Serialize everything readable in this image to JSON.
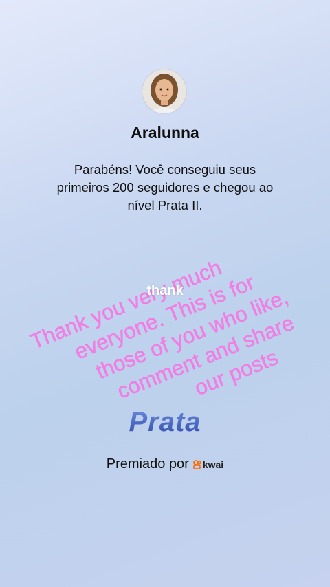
{
  "profile": {
    "username": "Aralunna",
    "avatar_icon": "user-avatar-photo"
  },
  "message": "Parabéns! Você conseguiu seus primeiros 200 seguidores e chegou ao nível Prata II.",
  "overlay": {
    "thank_word": "thank",
    "handwritten_lines": [
      "Thank you very much",
      "everyone. This is for",
      "those of you who like,",
      "comment and share",
      "our posts"
    ],
    "text_color": "#f07ee3"
  },
  "tier": {
    "name": "Prata",
    "color": "#3d55b5"
  },
  "awarded": {
    "label": "Premiado por",
    "brand": "kwai",
    "brand_color": "#ff6a00"
  }
}
